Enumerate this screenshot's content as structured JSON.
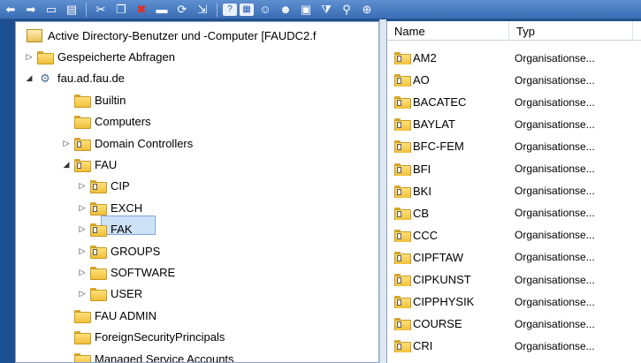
{
  "toolbar": {
    "buttons": [
      {
        "icon": "back-arrow-icon",
        "glyph": "⬅"
      },
      {
        "icon": "forward-arrow-icon",
        "glyph": "➡"
      },
      {
        "icon": "up-folder-icon",
        "glyph": "▭"
      },
      {
        "icon": "console-tree-icon",
        "glyph": "▤"
      },
      {
        "icon": "cut-icon",
        "glyph": "✂"
      },
      {
        "icon": "copy-icon",
        "glyph": "❐"
      },
      {
        "icon": "delete-icon",
        "glyph": "✖"
      },
      {
        "icon": "properties-icon",
        "glyph": "▬"
      },
      {
        "icon": "refresh-icon",
        "glyph": "⟳"
      },
      {
        "icon": "export-list-icon",
        "glyph": "⇲"
      },
      {
        "icon": "help-icon",
        "glyph": "?"
      },
      {
        "icon": "action-pane-icon",
        "glyph": "▦"
      },
      {
        "icon": "create-user-icon",
        "glyph": "☺"
      },
      {
        "icon": "create-group-icon",
        "glyph": "☻"
      },
      {
        "icon": "create-ou-icon",
        "glyph": "▣"
      },
      {
        "icon": "filter-icon",
        "glyph": "⧩"
      },
      {
        "icon": "find-icon",
        "glyph": "⚲"
      },
      {
        "icon": "add-to-group-icon",
        "glyph": "⊕"
      }
    ]
  },
  "tree": {
    "items": [
      {
        "label": "Active Directory-Benutzer und -Computer [FAUDC2.f",
        "icon": "ad-console-icon",
        "level": 0,
        "twisty": ""
      },
      {
        "label": "Gespeicherte Abfragen",
        "icon": "folder-icon",
        "level": 1,
        "twisty": "▷"
      },
      {
        "label": "fau.ad.fau.de",
        "icon": "domain-icon",
        "level": 1,
        "twisty": "◢"
      },
      {
        "label": "Builtin",
        "icon": "folder-icon",
        "level": 2,
        "twisty": ""
      },
      {
        "label": "Computers",
        "icon": "folder-icon",
        "level": 2,
        "twisty": ""
      },
      {
        "label": "Domain Controllers",
        "icon": "ou-icon",
        "level": 2,
        "twisty": "▷"
      },
      {
        "label": "FAU",
        "icon": "ou-icon",
        "level": 2,
        "twisty": "◢"
      },
      {
        "label": "CIP",
        "icon": "ou-icon",
        "level": 3,
        "twisty": "▷"
      },
      {
        "label": "EXCH",
        "icon": "ou-icon",
        "level": 3,
        "twisty": "▷"
      },
      {
        "label": "FAK",
        "icon": "ou-icon",
        "level": 3,
        "twisty": "▷"
      },
      {
        "label": "GROUPS",
        "icon": "ou-icon",
        "level": 3,
        "twisty": "▷"
      },
      {
        "label": "SOFTWARE",
        "icon": "folder-icon",
        "level": 3,
        "twisty": "▷"
      },
      {
        "label": "USER",
        "icon": "folder-icon",
        "level": 3,
        "twisty": "▷"
      },
      {
        "label": "FAU ADMIN",
        "icon": "folder-icon",
        "level": 2,
        "twisty": ""
      },
      {
        "label": "ForeignSecurityPrincipals",
        "icon": "folder-icon",
        "level": 2,
        "twisty": ""
      },
      {
        "label": "Managed Service Accounts",
        "icon": "folder-icon",
        "level": 2,
        "twisty": ""
      }
    ]
  },
  "list": {
    "columns": {
      "name": "Name",
      "type": "Typ"
    },
    "rows": [
      {
        "name": "AM2",
        "type": "Organisationse..."
      },
      {
        "name": "AO",
        "type": "Organisationse..."
      },
      {
        "name": "BACATEC",
        "type": "Organisationse..."
      },
      {
        "name": "BAYLAT",
        "type": "Organisationse..."
      },
      {
        "name": "BFC-FEM",
        "type": "Organisationse..."
      },
      {
        "name": "BFI",
        "type": "Organisationse..."
      },
      {
        "name": "BKI",
        "type": "Organisationse..."
      },
      {
        "name": "CB",
        "type": "Organisationse..."
      },
      {
        "name": "CCC",
        "type": "Organisationse..."
      },
      {
        "name": "CIPFTAW",
        "type": "Organisationse..."
      },
      {
        "name": "CIPKUNST",
        "type": "Organisationse..."
      },
      {
        "name": "CIPPHYSIK",
        "type": "Organisationse..."
      },
      {
        "name": "COURSE",
        "type": "Organisationse..."
      },
      {
        "name": "CRI",
        "type": "Organisationse..."
      }
    ]
  }
}
